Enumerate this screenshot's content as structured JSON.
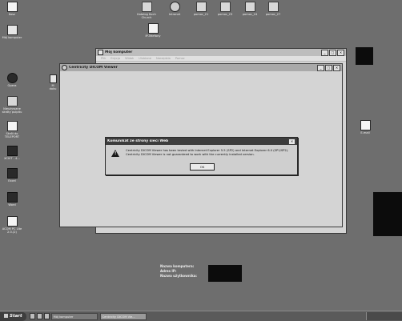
{
  "desktop_left": [
    {
      "name": "kosz",
      "label": "Kosz",
      "icon": "trash-icon"
    },
    {
      "name": "moj-komputer",
      "label": "Mój komputer",
      "icon": "computer-icon"
    },
    {
      "name": "opera",
      "label": "Opera",
      "icon": "opera-icon"
    },
    {
      "name": "niezywane",
      "label": "Nieużywane\nskróty pulpitu",
      "icon": "folder-icon"
    },
    {
      "name": "skrot-teleporty",
      "label": "Skrót do\nTELEPORT",
      "icon": "shortcut-icon"
    },
    {
      "name": "xcivt",
      "label": "XCIVT - 4...",
      "icon": "app-icon"
    },
    {
      "name": "excel",
      "label": "Excel",
      "icon": "excel-icon"
    },
    {
      "name": "word",
      "label": "Word",
      "icon": "word-icon"
    },
    {
      "name": "acom",
      "label": "ACOM PC Lite\n2.0.(2)",
      "icon": "app-icon"
    }
  ],
  "desktop_top": [
    {
      "name": "katalog",
      "label": "Katalog Kuch\nChurch",
      "icon": "folder-icon"
    },
    {
      "name": "intranet",
      "label": "Intranet",
      "icon": "globe-icon"
    },
    {
      "name": "pomoc-21",
      "label": "pomoc_21",
      "icon": "folder-icon"
    },
    {
      "name": "pomoc-23",
      "label": "pomoc_23",
      "icon": "folder-icon"
    },
    {
      "name": "pomoc-24",
      "label": "pomoc_24",
      "icon": "folder-icon"
    },
    {
      "name": "pomoc-27",
      "label": "pomoc_27",
      "icon": "folder-icon"
    },
    {
      "name": "ip-telefony",
      "label": "IP-Telefony",
      "icon": "phone-icon"
    }
  ],
  "desktop_right": {
    "label": "E-mail",
    "icon": "email-icon"
  },
  "behind_icon": {
    "label": "M\ndoku"
  },
  "window_mojkomputer": {
    "title": "Mój komputer",
    "menu": [
      "Plik",
      "Edycja",
      "Widok",
      "Ulubione",
      "Narzędzia",
      "Pomoc"
    ]
  },
  "window_dicom": {
    "title": "Centricity DICOM Viewer"
  },
  "dialog": {
    "title": "Komunikat ze strony sieci Web",
    "message": "Centricity DICOM Viewer has been tested with Internet Explorer 5.5 (SP2) and Internet Explorer 6.0 (SP1/SP2). Centricity DICOM Viewer is not guaranteed to work with the currently installed version.",
    "ok_label": "OK",
    "close_glyph": "✕"
  },
  "info_labels": {
    "computer": "Nazwa komputera:",
    "ip": "Adres IP:",
    "user": "Nazwa użytkownika:"
  },
  "taskbar": {
    "start_label": "Start",
    "tasks": [
      {
        "label": "Mój komputer",
        "active": false
      },
      {
        "label": "Centricity DICOM Vie...",
        "active": true
      }
    ]
  }
}
